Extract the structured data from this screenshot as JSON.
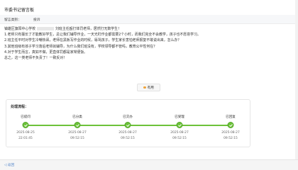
{
  "header": {
    "title": "市委书记留言板"
  },
  "info": {
    "label": "留言类别：",
    "value": "投诉"
  },
  "letter": {
    "line1_a": "镇雄区旗阳中心学校",
    "line1_b": "刘班主任殴打体罚老师，居然打无数学生！",
    "line2": "1.老师只有擅长了才能教好学生，总让我们辅导作业，一天光盯作业都需要2个小时，而我们完全不会教学，孩子也不愿意学习。",
    "line3": "2.班主任平时对学生冷嘲热讽，老师在黑板写作业的时候，辱骂孩子，学生家长害怕老师报复不敢说出来，怎么办？",
    "line4": "3.其他班级有孩子学习落后老师就辅导，为什么我们班没有，学校领导都不管吗，教育公平性何在？",
    "line5": "4.对于学生而言，真如不做，更直体罚都是家常便饭。",
    "line6": "总之，这一类老师不负责了！一致反对！"
  },
  "reply_button": {
    "label": "有用"
  },
  "progress": {
    "title": "处理流程：",
    "steps": [
      {
        "label": "已提问",
        "date": "2025-08-25",
        "time": "22:01:45"
      },
      {
        "label": "已分类",
        "date": "2025-08-27",
        "time": "09:52:15"
      },
      {
        "label": "已交办",
        "date": "2025-08-27",
        "time": "09:52:15"
      },
      {
        "label": "已受理",
        "date": "2025-08-27",
        "time": "09:52:15"
      },
      {
        "label": "已回复",
        "date": "2025-08-27",
        "time": "09:52:15"
      }
    ],
    "accent": "#6dc23b"
  },
  "footer": {
    "link": "◁ 返回"
  }
}
